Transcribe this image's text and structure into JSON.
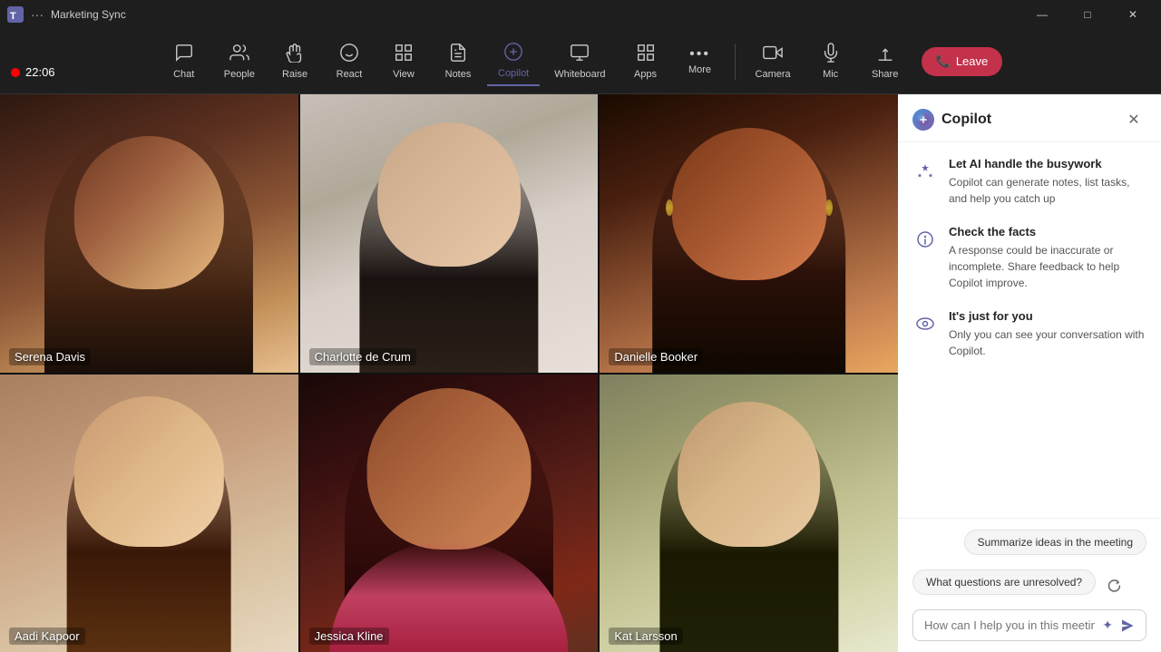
{
  "titleBar": {
    "appName": "Teams",
    "title": "Marketing Sync",
    "controls": {
      "minimize": "—",
      "maximize": "□",
      "close": "✕"
    }
  },
  "recording": {
    "dot": "●",
    "time": "22:06"
  },
  "toolbar": {
    "items": [
      {
        "id": "chat",
        "label": "Chat",
        "icon": "💬"
      },
      {
        "id": "people",
        "label": "People",
        "icon": "👤"
      },
      {
        "id": "raise",
        "label": "Raise",
        "icon": "✋"
      },
      {
        "id": "react",
        "label": "React",
        "icon": "😊"
      },
      {
        "id": "view",
        "label": "View",
        "icon": "⊞"
      },
      {
        "id": "notes",
        "label": "Notes",
        "icon": "📋"
      },
      {
        "id": "copilot",
        "label": "Copilot",
        "icon": "✨",
        "active": true
      },
      {
        "id": "whiteboard",
        "label": "Whiteboard",
        "icon": "⬜"
      },
      {
        "id": "apps",
        "label": "Apps",
        "icon": "⊞"
      },
      {
        "id": "more",
        "label": "More",
        "icon": "···"
      },
      {
        "id": "camera",
        "label": "Camera",
        "icon": "📷"
      },
      {
        "id": "mic",
        "label": "Mic",
        "icon": "🎤"
      },
      {
        "id": "share",
        "label": "Share",
        "icon": "↑"
      }
    ],
    "leaveButton": {
      "label": "Leave",
      "icon": "📞"
    }
  },
  "participants": [
    {
      "id": "serena",
      "name": "Serena Davis"
    },
    {
      "id": "charlotte",
      "name": "Charlotte de Crum"
    },
    {
      "id": "danielle",
      "name": "Danielle Booker"
    },
    {
      "id": "aadi",
      "name": "Aadi Kapoor"
    },
    {
      "id": "jessica",
      "name": "Jessica Kline"
    },
    {
      "id": "kat",
      "name": "Kat Larsson"
    }
  ],
  "copilot": {
    "title": "Copilot",
    "closeIcon": "✕",
    "sections": [
      {
        "id": "busywork",
        "icon": "✦",
        "title": "Let AI handle the busywork",
        "description": "Copilot can generate notes, list tasks, and help you catch up"
      },
      {
        "id": "facts",
        "icon": "🔍",
        "title": "Check the facts",
        "description": "A response could be inaccurate or incomplete. Share feedback to help Copilot improve."
      },
      {
        "id": "personal",
        "icon": "👁",
        "title": "It's just for you",
        "description": "Only you can see your conversation with Copilot."
      }
    ],
    "suggestions": [
      {
        "id": "summarize",
        "label": "Summarize ideas in the meeting"
      },
      {
        "id": "questions",
        "label": "What questions are unresolved?"
      }
    ],
    "inputPlaceholder": "How can I help you in this meeting?",
    "sendIcon": "➤",
    "sparkleIcon": "✦"
  }
}
